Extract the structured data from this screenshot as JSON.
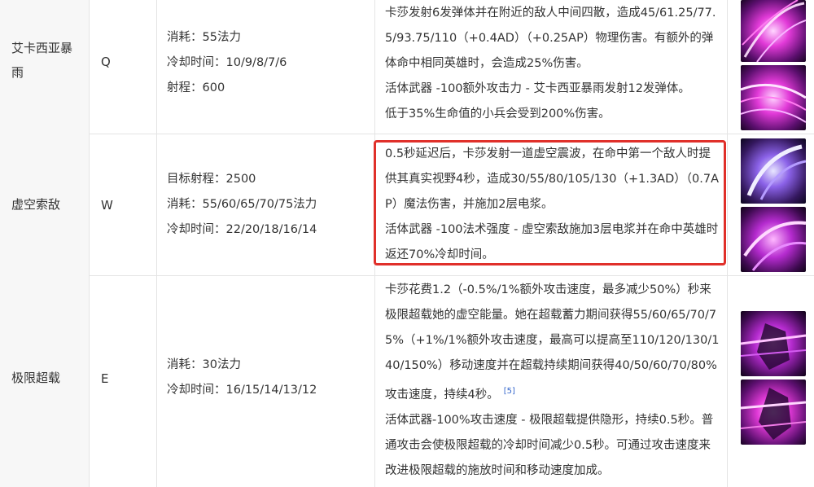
{
  "abilities": [
    {
      "name": "艾卡西亚暴雨",
      "key": "Q",
      "stats": [
        "消耗：55法力",
        "冷却时间：10/9/8/7/6",
        "射程：600"
      ],
      "description": [
        "卡莎发射6发弹体并在附近的敌人中间四散，造成45/61.25/77.5/93.75/110（+0.4AD）（+0.25AP）物理伤害。有额外的弹体命中相同英雄时，会造成25%伤害。",
        "活体武器 -100额外攻击力 - 艾卡西亚暴雨发射12发弹体。",
        "低于35%生命值的小兵会受到200%伤害。"
      ],
      "image_icons": [
        "ability-q-image-top",
        "ability-q-image-bottom"
      ],
      "highlighted": false
    },
    {
      "name": "虚空索敌",
      "key": "W",
      "stats": [
        "目标射程：2500",
        "消耗：55/60/65/70/75法力",
        "冷却时间：22/20/18/16/14"
      ],
      "description": [
        "0.5秒延迟后，卡莎发射一道虚空震波，在命中第一个敌人时提供其真实视野4秒，造成30/55/80/105/130（+1.3AD）（0.7AP）魔法伤害，并施加2层电浆。",
        "活体武器 -100法术强度 - 虚空索敌施加3层电浆并在命中英雄时返还70%冷却时间。"
      ],
      "image_icons": [
        "ability-w-image-top",
        "ability-w-image-bottom"
      ],
      "highlighted": true
    },
    {
      "name": "极限超载",
      "key": "E",
      "stats": [
        "消耗：30法力",
        "冷却时间：16/15/14/13/12"
      ],
      "description": [
        "卡莎花费1.2（-0.5%/1%额外攻击速度，最多减少50%）秒来极限超载她的虚空能量。她在超载蓄力期间获得55/60/65/70/75%（+1%/1%额外攻击速度，最高可以提高至110/120/130/140/150%）移动速度并在超载持续期间获得40/50/60/70/80%攻击速度，持续4秒。",
        "活体武器-100%攻击速度 - 极限超载提供隐形，持续0.5秒。普通攻击会使极限超载的冷却时间减少0.5秒。可通过攻击速度来改进极限超载的施放时间和移动速度加成。"
      ],
      "reference": "[5]",
      "image_icons": [
        "ability-e-image-top",
        "ability-e-image-bottom"
      ],
      "highlighted": false
    }
  ],
  "colors": {
    "highlight_border": "#e0302a",
    "reference_link": "#3366cc",
    "name_cell_bg": "#f7f7f7",
    "grid_line": "#e4e4e4"
  }
}
